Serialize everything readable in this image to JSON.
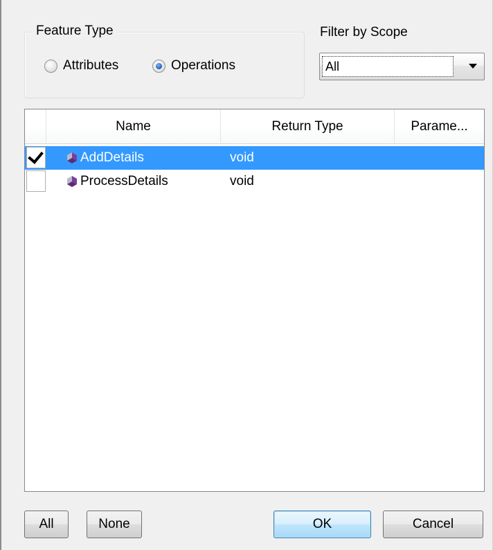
{
  "feature_type": {
    "legend": "Feature Type",
    "options": [
      {
        "label": "Attributes",
        "checked": false
      },
      {
        "label": "Operations",
        "checked": true
      }
    ]
  },
  "scope": {
    "label": "Filter by Scope",
    "selected": "All"
  },
  "table": {
    "columns": [
      "Name",
      "Return Type",
      "Parame..."
    ],
    "rows": [
      {
        "checked": true,
        "selected": true,
        "name": "AddDetails",
        "return_type": "void",
        "icon": "operation-icon"
      },
      {
        "checked": false,
        "selected": false,
        "name": "ProcessDetails",
        "return_type": "void",
        "icon": "operation-icon"
      }
    ]
  },
  "buttons": {
    "all": "All",
    "none": "None",
    "ok": "OK",
    "cancel": "Cancel"
  },
  "colors": {
    "selection": "#3399ff",
    "icon": "#7a3e9d"
  }
}
